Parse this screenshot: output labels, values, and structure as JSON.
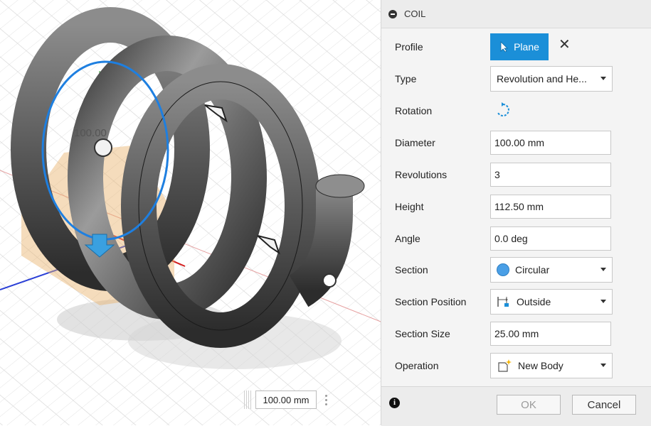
{
  "viewport": {
    "dimension_label": "100.00",
    "floating_dimension_value": "100.00 mm"
  },
  "panel": {
    "title": "COIL",
    "rows": {
      "profile": {
        "label": "Profile",
        "button": "Plane"
      },
      "type": {
        "label": "Type",
        "value": "Revolution and He..."
      },
      "rotation": {
        "label": "Rotation"
      },
      "diameter": {
        "label": "Diameter",
        "value": "100.00 mm"
      },
      "revolutions": {
        "label": "Revolutions",
        "value": "3"
      },
      "height": {
        "label": "Height",
        "value": "112.50 mm"
      },
      "angle": {
        "label": "Angle",
        "value": "0.0 deg"
      },
      "section": {
        "label": "Section",
        "value": "Circular"
      },
      "section_position": {
        "label": "Section Position",
        "value": "Outside"
      },
      "section_size": {
        "label": "Section Size",
        "value": "25.00 mm"
      },
      "operation": {
        "label": "Operation",
        "value": "New Body"
      }
    },
    "footer": {
      "ok": "OK",
      "cancel": "Cancel"
    }
  },
  "colors": {
    "accent": "#1b8fd8",
    "section_icon": "#4a9fe6"
  }
}
